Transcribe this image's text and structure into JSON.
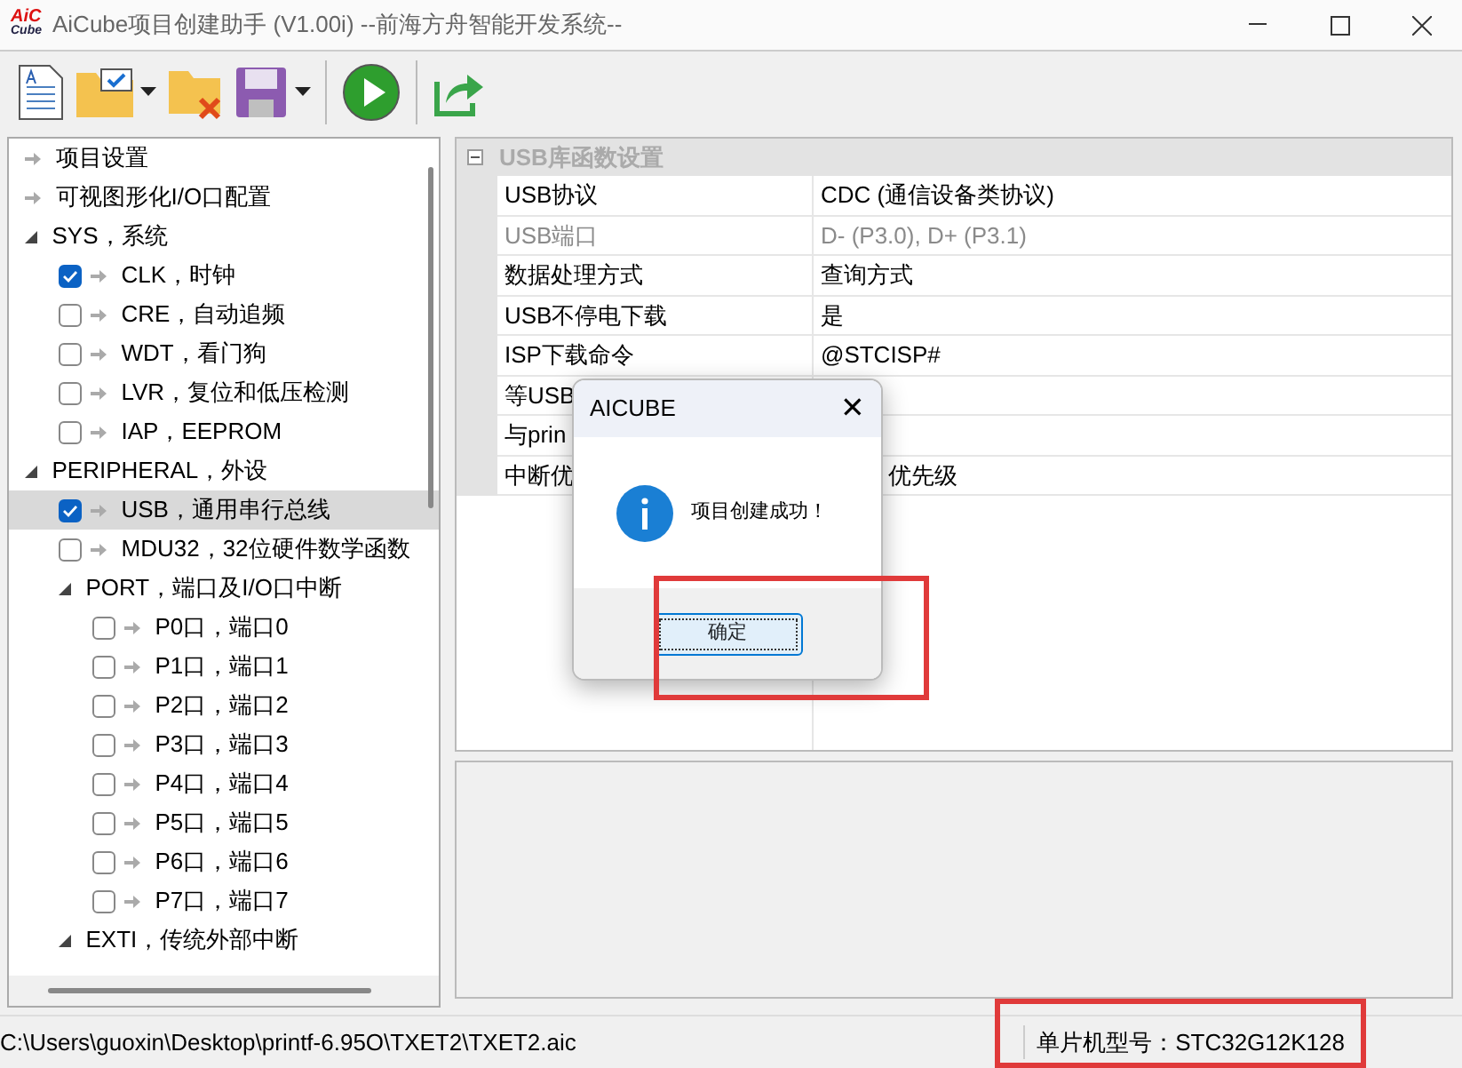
{
  "window": {
    "logo": [
      "AiC",
      "Cube"
    ],
    "title": "AiCube项目创建助手 (V1.00i) --前海方舟智能开发系统--"
  },
  "toolbar": [
    {
      "kind": "new"
    },
    {
      "kind": "open",
      "dropdown": true
    },
    {
      "kind": "close"
    },
    {
      "kind": "save",
      "dropdown": true
    },
    {
      "kind": "run"
    },
    {
      "kind": "export"
    }
  ],
  "tree": [
    {
      "kind": "link",
      "label": "项目设置",
      "selected": false
    },
    {
      "kind": "link",
      "label": "可视图形化I/O口配置",
      "selected": false
    },
    {
      "kind": "group",
      "label": "SYS，系统",
      "expanded": true,
      "selected": false,
      "children": [
        {
          "kind": "option",
          "label": "CLK，时钟",
          "checked": true,
          "selected": false
        },
        {
          "kind": "option",
          "label": "CRE，自动追频",
          "checked": false,
          "selected": false
        },
        {
          "kind": "option",
          "label": "WDT，看门狗",
          "checked": false,
          "selected": false
        },
        {
          "kind": "option",
          "label": "LVR，复位和低压检测",
          "checked": false,
          "selected": false
        },
        {
          "kind": "option",
          "label": "IAP，EEPROM",
          "checked": false,
          "selected": false
        }
      ]
    },
    {
      "kind": "group",
      "label": "PERIPHERAL，外设",
      "expanded": true,
      "selected": false,
      "children": [
        {
          "kind": "option",
          "label": "USB，通用串行总线",
          "checked": true,
          "selected": true
        },
        {
          "kind": "option",
          "label": "MDU32，32位硬件数学函数",
          "checked": false,
          "selected": false
        },
        {
          "kind": "group",
          "label": "PORT，端口及I/O口中断",
          "expanded": true,
          "selected": false,
          "children": [
            {
              "kind": "option",
              "label": "P0口，端口0",
              "checked": false,
              "selected": false
            },
            {
              "kind": "option",
              "label": "P1口，端口1",
              "checked": false,
              "selected": false
            },
            {
              "kind": "option",
              "label": "P2口，端口2",
              "checked": false,
              "selected": false
            },
            {
              "kind": "option",
              "label": "P3口，端口3",
              "checked": false,
              "selected": false
            },
            {
              "kind": "option",
              "label": "P4口，端口4",
              "checked": false,
              "selected": false
            },
            {
              "kind": "option",
              "label": "P5口，端口5",
              "checked": false,
              "selected": false
            },
            {
              "kind": "option",
              "label": "P6口，端口6",
              "checked": false,
              "selected": false
            },
            {
              "kind": "option",
              "label": "P7口，端口7",
              "checked": false,
              "selected": false
            }
          ]
        },
        {
          "kind": "group",
          "label": "EXTI，传统外部中断",
          "expanded": true,
          "selected": false
        }
      ]
    }
  ],
  "properties": {
    "section": "USB库函数设置",
    "expanded": true,
    "rows": [
      {
        "name": "USB协议",
        "value": "CDC (通信设备类协议)",
        "disabled": false
      },
      {
        "name": "USB端口",
        "value": "D- (P3.0), D+ (P3.1)",
        "disabled": true
      },
      {
        "name": "数据处理方式",
        "value": "查询方式",
        "disabled": false
      },
      {
        "name": "USB不停电下载",
        "value": "是",
        "disabled": false
      },
      {
        "name": "ISP下载命令",
        "value": "@STCISP#",
        "disabled": false
      },
      {
        "name": "等USB",
        "disabled": false
      },
      {
        "name": "与prin",
        "disabled": false
      },
      {
        "name": "中断优",
        "value": "优先级",
        "disabled": false
      }
    ]
  },
  "dialog": {
    "title": "AICUBE",
    "close": "✕",
    "message": "项目创建成功！",
    "button": "确定"
  },
  "status_bar": {
    "path": "C:\\Users\\guoxin\\Desktop\\printf-6.95O\\TXET2\\TXET2.aic",
    "model": "单片机型号：STC32G12K128"
  }
}
